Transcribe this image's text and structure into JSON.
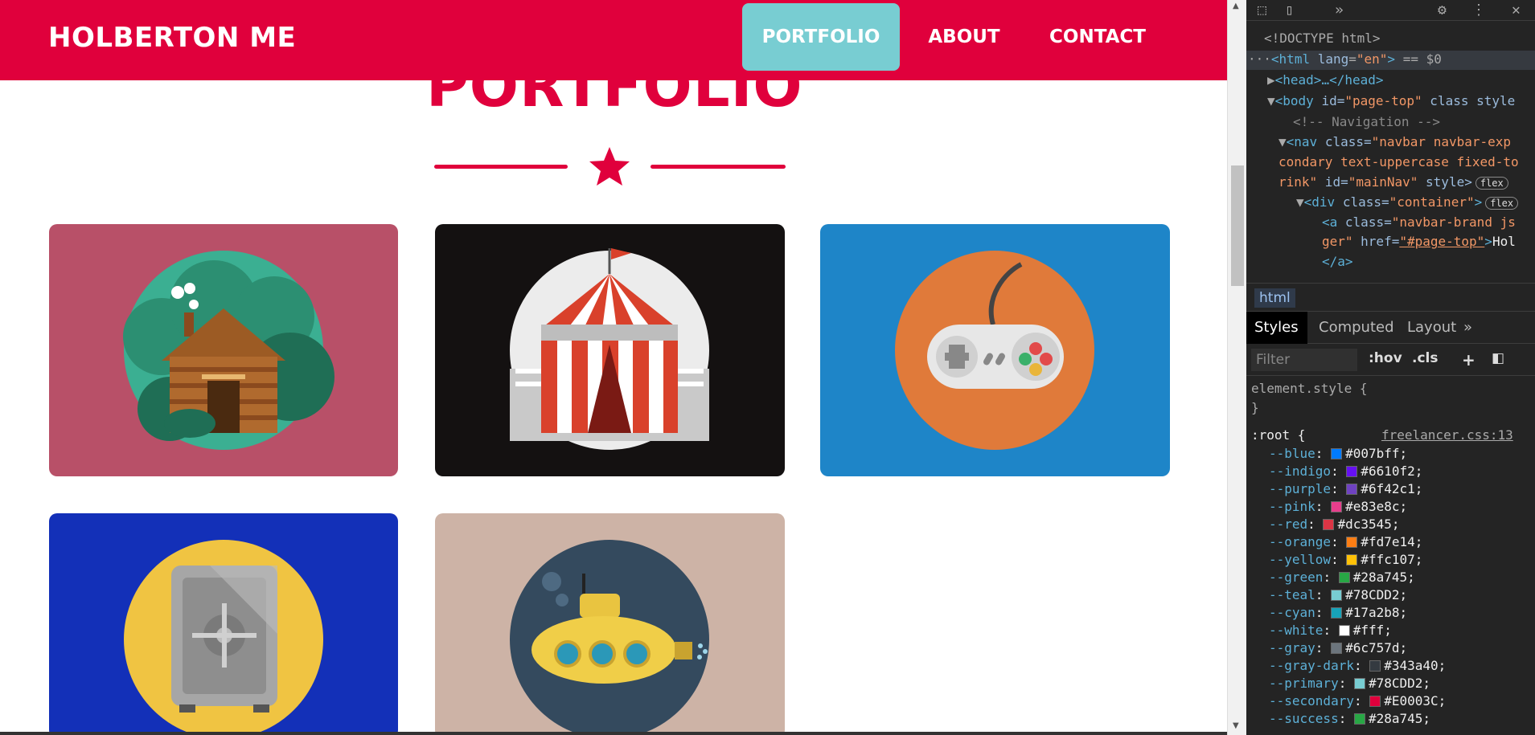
{
  "site": {
    "brand": "HOLBERTON ME",
    "nav": [
      {
        "label": "PORTFOLIO",
        "active": true
      },
      {
        "label": "ABOUT",
        "active": false
      },
      {
        "label": "CONTACT",
        "active": false
      }
    ],
    "section_title": "PORTFOLIO",
    "cards": [
      {
        "name": "cabin",
        "bg": "#B85068",
        "circle": "#3BAF92"
      },
      {
        "name": "circus-tent",
        "bg": "#141111",
        "circle": "#ECECEC"
      },
      {
        "name": "game-controller",
        "bg": "#1E85C8",
        "circle": "#E07A3A"
      },
      {
        "name": "safe",
        "bg": "#1330B8",
        "circle": "#F0C442"
      },
      {
        "name": "submarine",
        "bg": "#CDB3A6",
        "circle": "#344A5E"
      }
    ],
    "colors": {
      "primary": "#78CDD2",
      "secondary": "#E0003C"
    }
  },
  "devtools": {
    "toolbar_icons": [
      "inspect-icon",
      "device-toggle-icon",
      "more-tabs-icon",
      "settings-icon",
      "kebab-menu-icon",
      "close-icon"
    ],
    "dom": {
      "doctype": "<!DOCTYPE html>",
      "html_open_tag": "html",
      "html_attr_name": "lang",
      "html_attr_value": "\"en\"",
      "html_selected_marker": "== $0",
      "head": "<head>…</head>",
      "body_tag": "body",
      "body_attr_text": " id=",
      "body_id": "\"page-top\"",
      "body_class": " class style",
      "comment": "<!-- Navigation -->",
      "nav_tag": "nav",
      "nav_class_attr": " class=",
      "nav_class_line1": "\"navbar navbar-exp",
      "nav_class_line2": "condary text-uppercase fixed-to",
      "nav_class_line3": "rink\"",
      "nav_id_attr": " id=",
      "nav_id": "\"mainNav\"",
      "nav_style": " style>",
      "flex_badge": "flex",
      "div_tag": "div",
      "div_class": "\"container\"",
      "a_tag_line1": "a",
      "a_attr": " class=",
      "a_class": "\"navbar-brand js",
      "a_class_line2": "ger\"",
      "a_href_attr": " href=",
      "a_href": "\"#page-top\"",
      "a_text": "Hol",
      "a_close": "</a>"
    },
    "breadcrumb": "html",
    "tabs": [
      "Styles",
      "Computed",
      "Layout"
    ],
    "tabs_more": "»",
    "filter_placeholder": "Filter",
    "filter_hov": ":hov",
    "filter_cls": ".cls",
    "filter_plus": "+",
    "element_style_open": "element.style {",
    "element_style_close": "}",
    "root_selector": ":root {",
    "root_source": "freelancer.css:13",
    "css_vars": [
      {
        "name": "--blue",
        "value": "#007bff"
      },
      {
        "name": "--indigo",
        "value": "#6610f2"
      },
      {
        "name": "--purple",
        "value": "#6f42c1"
      },
      {
        "name": "--pink",
        "value": "#e83e8c"
      },
      {
        "name": "--red",
        "value": "#dc3545"
      },
      {
        "name": "--orange",
        "value": "#fd7e14"
      },
      {
        "name": "--yellow",
        "value": "#ffc107"
      },
      {
        "name": "--green",
        "value": "#28a745"
      },
      {
        "name": "--teal",
        "value": "#78CDD2"
      },
      {
        "name": "--cyan",
        "value": "#17a2b8"
      },
      {
        "name": "--white",
        "value": "#fff"
      },
      {
        "name": "--gray",
        "value": "#6c757d"
      },
      {
        "name": "--gray-dark",
        "value": "#343a40"
      },
      {
        "name": "--primary",
        "value": "#78CDD2"
      },
      {
        "name": "--secondary",
        "value": "#E0003C"
      },
      {
        "name": "--success",
        "value": "#28a745"
      }
    ]
  }
}
